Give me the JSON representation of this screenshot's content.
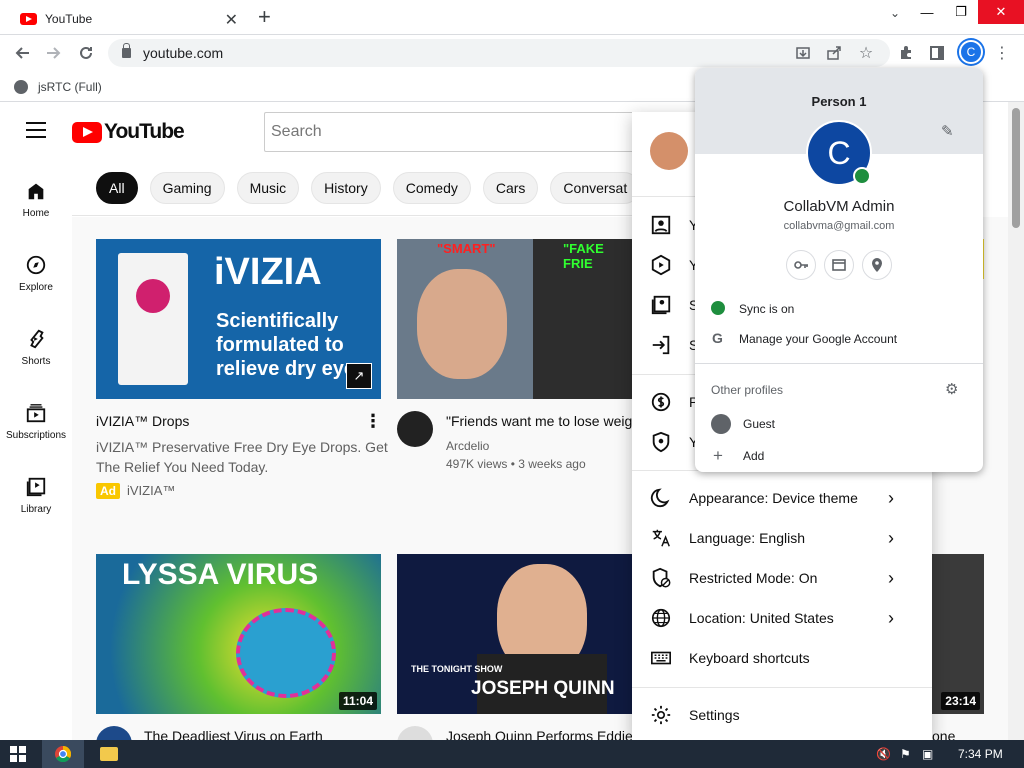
{
  "browser": {
    "tab_title": "YouTube",
    "url": "youtube.com",
    "bookmark": "jsRTC (Full)",
    "profile_initial": "C"
  },
  "youtube": {
    "logo": "YouTube",
    "search_placeholder": "Search",
    "guide": [
      {
        "label": "Home",
        "icon": "home-icon"
      },
      {
        "label": "Explore",
        "icon": "compass-icon"
      },
      {
        "label": "Shorts",
        "icon": "shorts-icon"
      },
      {
        "label": "Subscriptions",
        "icon": "subscriptions-icon"
      },
      {
        "label": "Library",
        "icon": "library-icon"
      }
    ],
    "chips": [
      "All",
      "Gaming",
      "Music",
      "History",
      "Comedy",
      "Cars",
      "Conversat"
    ],
    "videos": [
      {
        "thumb_text": [
          "iVIZIA",
          "Scientifically",
          "formulated to",
          "relieve dry eye"
        ],
        "title": "iVIZIA™ Drops",
        "desc1": "iVIZIA™ Preservative Free Dry Eye Drops. Get",
        "desc2": "The Relief You Need Today.",
        "ad_label": "Ad",
        "advertiser": "iVIZIA™"
      },
      {
        "thumb_text": [
          "\"SMART\"",
          "\"FAKE FRIE"
        ],
        "title": "\"Friends want me to lose weig",
        "channel": "Arcdelio",
        "meta": "497K views • 3 weeks ago"
      },
      {
        "thumb_text": [
          "LYSSA VIRUS"
        ],
        "title": "The Deadliest Virus on Earth",
        "duration": "11:04"
      },
      {
        "thumb_text": [
          "THE TONIGHT SHOW",
          "JOSEPH QUINN"
        ],
        "title": "Joseph Quinn Performs Eddie"
      },
      {
        "duration": "23:14",
        "title": "one"
      }
    ]
  },
  "yt_menu": {
    "items": [
      {
        "label": "Appearance: Device theme",
        "icon": "moon-icon",
        "chevron": true
      },
      {
        "label": "Language: English",
        "icon": "translate-icon",
        "chevron": true
      },
      {
        "label": "Restricted Mode: On",
        "icon": "restricted-icon",
        "chevron": true
      },
      {
        "label": "Location: United States",
        "icon": "globe-icon",
        "chevron": true
      },
      {
        "label": "Keyboard shortcuts",
        "icon": "keyboard-icon",
        "chevron": false
      },
      {
        "label": "Settings",
        "icon": "settings-icon",
        "chevron": false
      }
    ],
    "partial_labels": [
      "Y",
      "Y",
      "S",
      "S",
      "P",
      "Y"
    ]
  },
  "profile_menu": {
    "person": "Person 1",
    "avatar_letter": "C",
    "name": "CollabVM Admin",
    "email": "collabvma@gmail.com",
    "sync": "Sync is on",
    "manage": "Manage your Google Account",
    "other_profiles": "Other profiles",
    "guest": "Guest",
    "add": "Add"
  },
  "taskbar": {
    "time": "7:34 PM"
  },
  "colors": {
    "yt_red": "#ff0000",
    "chrome_blue": "#1a73e8",
    "sync_green": "#1e8e3e"
  }
}
